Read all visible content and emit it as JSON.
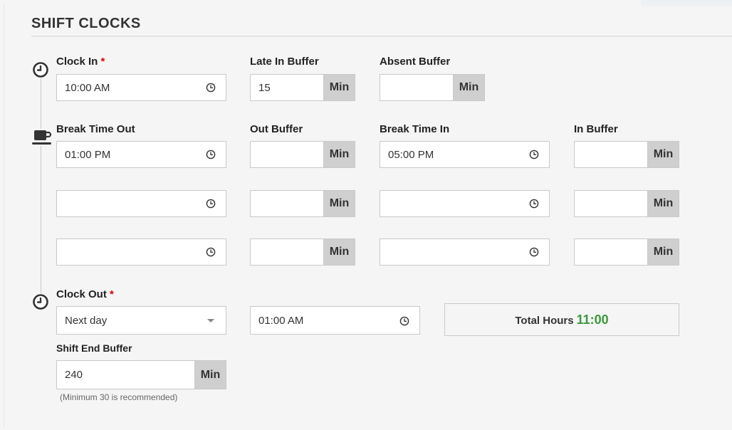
{
  "section": {
    "title": "SHIFT CLOCKS"
  },
  "units": {
    "min": "Min"
  },
  "clock_in": {
    "label": "Clock In",
    "required_mark": "*",
    "value": "10:00 AM"
  },
  "late_in_buffer": {
    "label": "Late In Buffer",
    "value": "15"
  },
  "absent_buffer": {
    "label": "Absent Buffer",
    "value": ""
  },
  "breaks": {
    "headers": {
      "time_out": "Break Time Out",
      "out_buffer": "Out Buffer",
      "time_in": "Break Time In",
      "in_buffer": "In Buffer"
    },
    "rows": [
      {
        "time_out": "01:00 PM",
        "out_buffer": "",
        "time_in": "05:00 PM",
        "in_buffer": ""
      },
      {
        "time_out": "",
        "out_buffer": "",
        "time_in": "",
        "in_buffer": ""
      },
      {
        "time_out": "",
        "out_buffer": "",
        "time_in": "",
        "in_buffer": ""
      }
    ]
  },
  "clock_out": {
    "label": "Clock Out",
    "required_mark": "*",
    "day_option": "Next day",
    "time": "01:00 AM"
  },
  "total_hours": {
    "label": "Total Hours",
    "value": "11:00",
    "value_color": "#3a9a3a"
  },
  "shift_end_buffer": {
    "label": "Shift End Buffer",
    "value": "240",
    "hint": "(Minimum 30 is recommended)"
  },
  "icons": {
    "timeline_top": "clock-icon",
    "timeline_break": "coffee-cup-icon",
    "timeline_bottom": "clock-icon",
    "field": "clock-icon"
  }
}
